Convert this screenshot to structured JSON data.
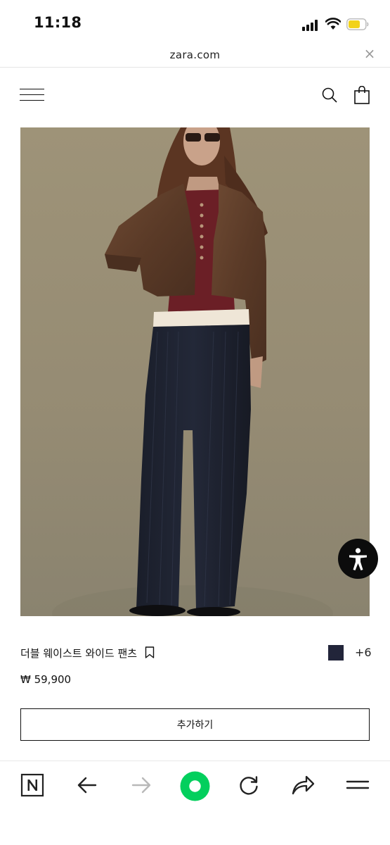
{
  "status": {
    "time": "11:18"
  },
  "urlbar": {
    "url": "zara.com",
    "close_glyph": "×"
  },
  "header": {
    "menu_icon": "hamburger-menu-icon",
    "search_icon": "search-icon",
    "bag_icon": "shopping-bag-icon"
  },
  "product": {
    "name": "더블 웨이스트 와이드 팬츠",
    "price": "₩ 59,900",
    "color_swatch": "#22253a",
    "more_colors": "+6",
    "add_button": "추가하기"
  },
  "accessibility": {
    "icon": "accessibility-icon"
  },
  "toolbar": {
    "items": [
      "naver-home-icon",
      "back-arrow-icon",
      "forward-arrow-icon",
      "green-home-icon",
      "reload-icon",
      "share-icon",
      "menu-icon"
    ],
    "accent": "#03cf5d"
  }
}
